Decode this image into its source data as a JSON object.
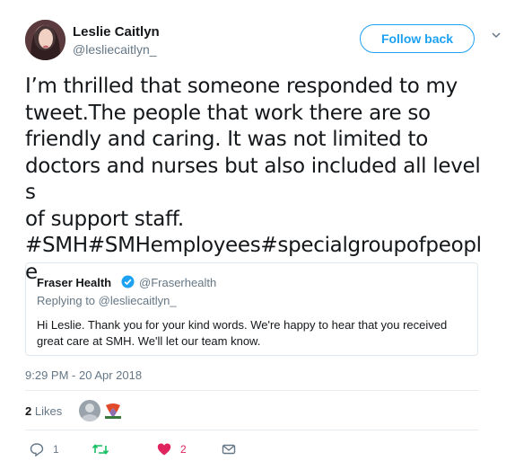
{
  "author": {
    "name": "Leslie Caitlyn",
    "handle": "@lesliecaitlyn_"
  },
  "follow_button": "Follow back",
  "tweet": {
    "line1": "I’m thrilled that someone responded to my",
    "line2": "tweet.The people that work there are so",
    "line3": "friendly and caring. It was not limited to",
    "line4": "doctors and nurses but also included all levels",
    "line5": "of support staff.",
    "hashtags_line1": "#SMH#SMHemployees#specialgroupofpeopl",
    "hashtags_line2": "e"
  },
  "quoted": {
    "name": "Fraser Health",
    "handle": "@Fraserhealth",
    "replying_to": "Replying to @lesliecaitlyn_",
    "text": "Hi Leslie. Thank you for your kind words. We're happy to hear that you received great care at SMH. We'll let our team know."
  },
  "timestamp": "9:29 PM - 20 Apr 2018",
  "stats": {
    "likes_count": "2",
    "likes_label": "Likes"
  },
  "actions": {
    "reply_count": "1",
    "like_count": "2"
  },
  "colors": {
    "accent": "#1da1f2",
    "retweet": "#17bf63",
    "like": "#e0245e",
    "muted": "#657786"
  },
  "icons": [
    "chevron-down-icon",
    "verified-badge-icon",
    "reply-icon",
    "retweet-icon",
    "heart-icon",
    "envelope-icon"
  ]
}
